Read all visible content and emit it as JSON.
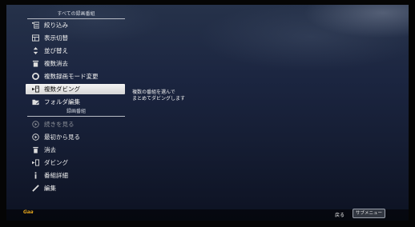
{
  "menu": {
    "section1_title": "すべての録画番組",
    "section2_title": "録画番組",
    "items": [
      {
        "label": "絞り込み",
        "icon": "filter-icon"
      },
      {
        "label": "表示切替",
        "icon": "view-switch-icon"
      },
      {
        "label": "並び替え",
        "icon": "sort-icon"
      },
      {
        "label": "複数消去",
        "icon": "multi-delete-icon"
      },
      {
        "label": "複数録画モード変更",
        "icon": "record-mode-icon"
      },
      {
        "label": "複数ダビング",
        "icon": "multi-dubbing-icon"
      },
      {
        "label": "フォルダ編集",
        "icon": "folder-edit-icon"
      },
      {
        "label": "続きを見る",
        "icon": "resume-icon"
      },
      {
        "label": "最初から見る",
        "icon": "play-from-start-icon"
      },
      {
        "label": "消去",
        "icon": "delete-icon"
      },
      {
        "label": "ダビング",
        "icon": "dubbing-icon"
      },
      {
        "label": "番組詳細",
        "icon": "info-icon"
      },
      {
        "label": "編集",
        "icon": "edit-icon"
      }
    ]
  },
  "description": {
    "line1": "複数の番組を選んで",
    "line2": "まとめてダビングします"
  },
  "footer": {
    "logo": "Gaa",
    "return_label": "戻る",
    "submenu_button": "サブメニュー"
  },
  "colors": {
    "selected_bg": "#e6e6e6",
    "logo": "#e0a21c"
  }
}
